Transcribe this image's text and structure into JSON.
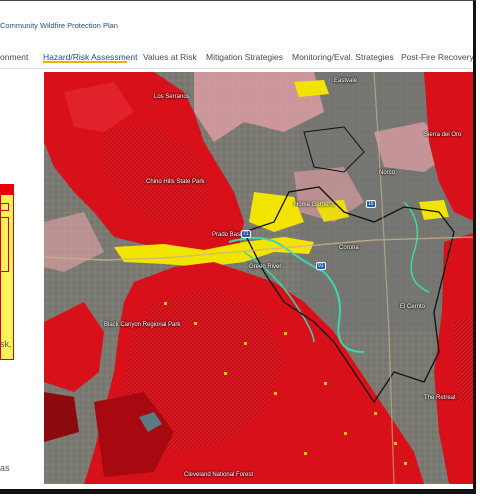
{
  "app": {
    "title": "Community Wildfire Protection Plan"
  },
  "nav": {
    "tabs": [
      {
        "label": "onment"
      },
      {
        "label": "Hazard/Risk Assessment"
      },
      {
        "label": "Values at Risk"
      },
      {
        "label": "Mitigation Strategies"
      },
      {
        "label": "Monitoring/Eval. Strategies"
      },
      {
        "label": "Post-Fire Recovery"
      }
    ],
    "active_tab": "Hazard/Risk Assessment",
    "underline_color": "#e8b400"
  },
  "left_panel": {
    "snippets": [
      "sk,",
      "as"
    ]
  },
  "map": {
    "labels": [
      "Eastvale",
      "Los Serranos",
      "Chino Hills State Park",
      "Corona",
      "Prado Basin",
      "El Cerrito",
      "Home Gardens",
      "Black Canyon Regional Park",
      "Cleveland National Forest",
      "The Retreat",
      "Norco",
      "Sierra del Oro",
      "Green River"
    ],
    "shields": [
      "71",
      "91",
      "15"
    ],
    "colors": {
      "very_high": "#d8101a",
      "high": "#b80a12",
      "moderate": "#f2e400",
      "low": "#e8a3a8",
      "urban": "#6e6e68",
      "boundary": "#111111",
      "waterway": "#3fd6b0"
    }
  }
}
